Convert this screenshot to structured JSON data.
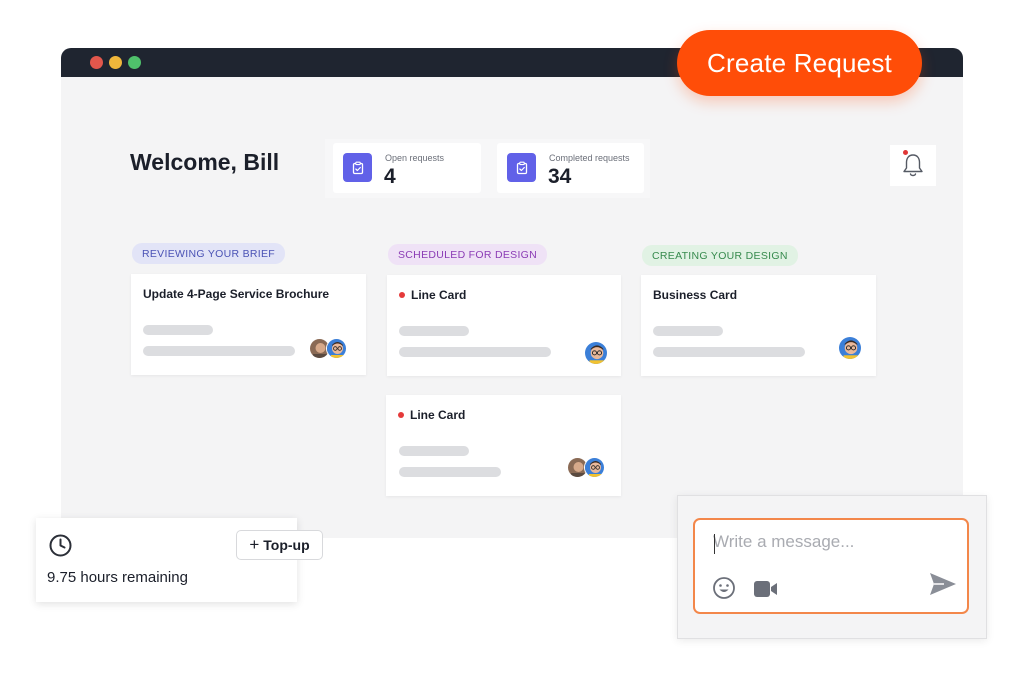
{
  "header": {
    "create_button": "Create Request",
    "welcome": "Welcome, Bill"
  },
  "stats": [
    {
      "label": "Open requests",
      "value": "4",
      "icon": "clipboard-icon"
    },
    {
      "label": "Completed requests",
      "value": "34",
      "icon": "clipboard-icon"
    }
  ],
  "notifications": {
    "icon": "bell-icon",
    "has_unread": true
  },
  "columns": [
    {
      "tag": "REVIEWING YOUR BRIEF",
      "cards": [
        {
          "title": "Update 4-Page Service Brochure",
          "urgent": false
        }
      ]
    },
    {
      "tag": "SCHEDULED FOR DESIGN",
      "cards": [
        {
          "title": "Line Card",
          "urgent": true
        },
        {
          "title": "Line Card",
          "urgent": true
        }
      ]
    },
    {
      "tag": "CREATING YOUR DESIGN",
      "cards": [
        {
          "title": "Business Card",
          "urgent": false
        }
      ]
    }
  ],
  "hours": {
    "icon": "clock-icon",
    "topup_label": "Top-up",
    "remaining": "9.75 hours remaining"
  },
  "message": {
    "placeholder": "Write a message...",
    "value": ""
  },
  "colors": {
    "accent": "#ff4d08",
    "stat_icon": "#6161e8",
    "urgent": "#e53a3a",
    "message_border": "#f3874a"
  }
}
